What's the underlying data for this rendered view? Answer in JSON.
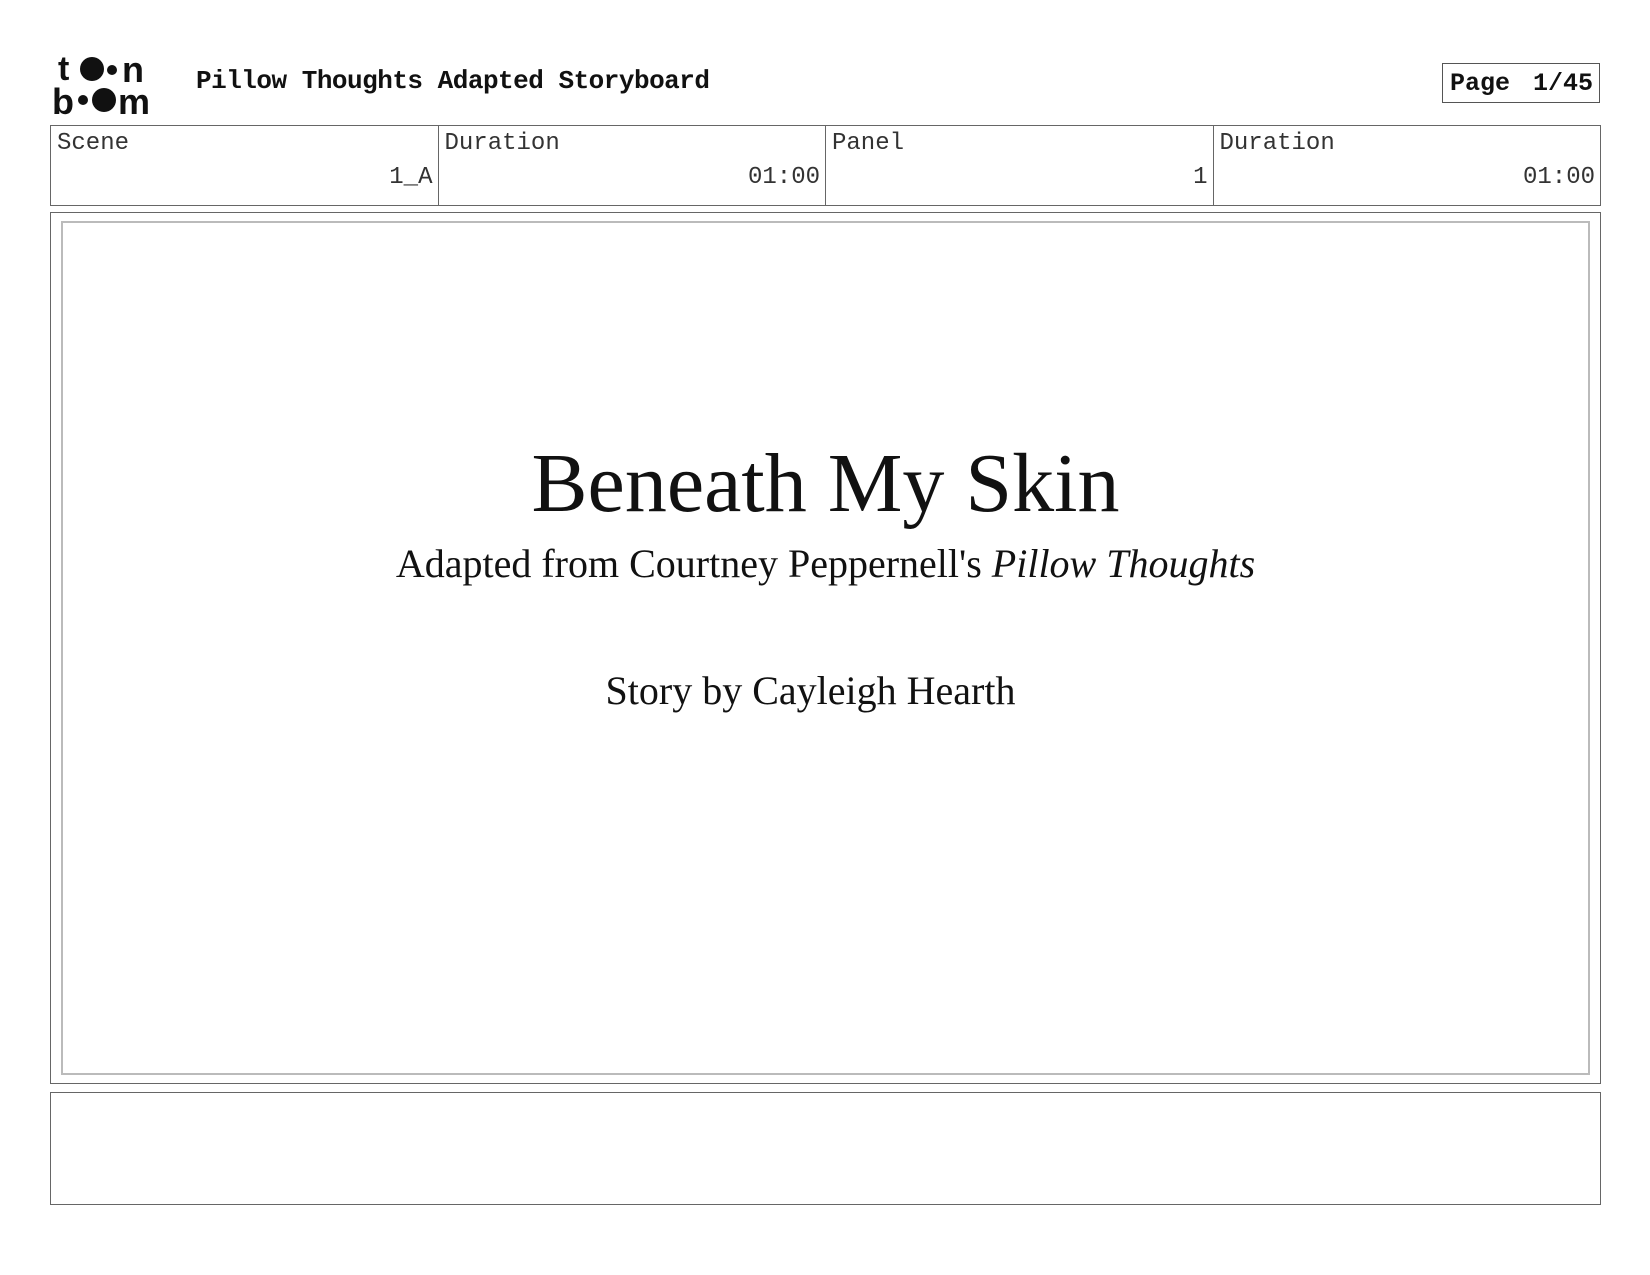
{
  "header": {
    "logo_text": "toon boom",
    "document_title": "Pillow Thoughts Adapted Storyboard",
    "page_label": "Page",
    "page_number": "1/45"
  },
  "info_row": [
    {
      "label": "Scene",
      "value": "1_A"
    },
    {
      "label": "Duration",
      "value": "01:00"
    },
    {
      "label": "Panel",
      "value": "1"
    },
    {
      "label": "Duration",
      "value": "01:00"
    }
  ],
  "panel": {
    "title": "Beneath My Skin",
    "subtitle_prefix": "Adapted from Courtney Peppernell's ",
    "subtitle_book": "Pillow Thoughts",
    "credit": "Story by Cayleigh Hearth"
  },
  "notes": {
    "text": ""
  }
}
